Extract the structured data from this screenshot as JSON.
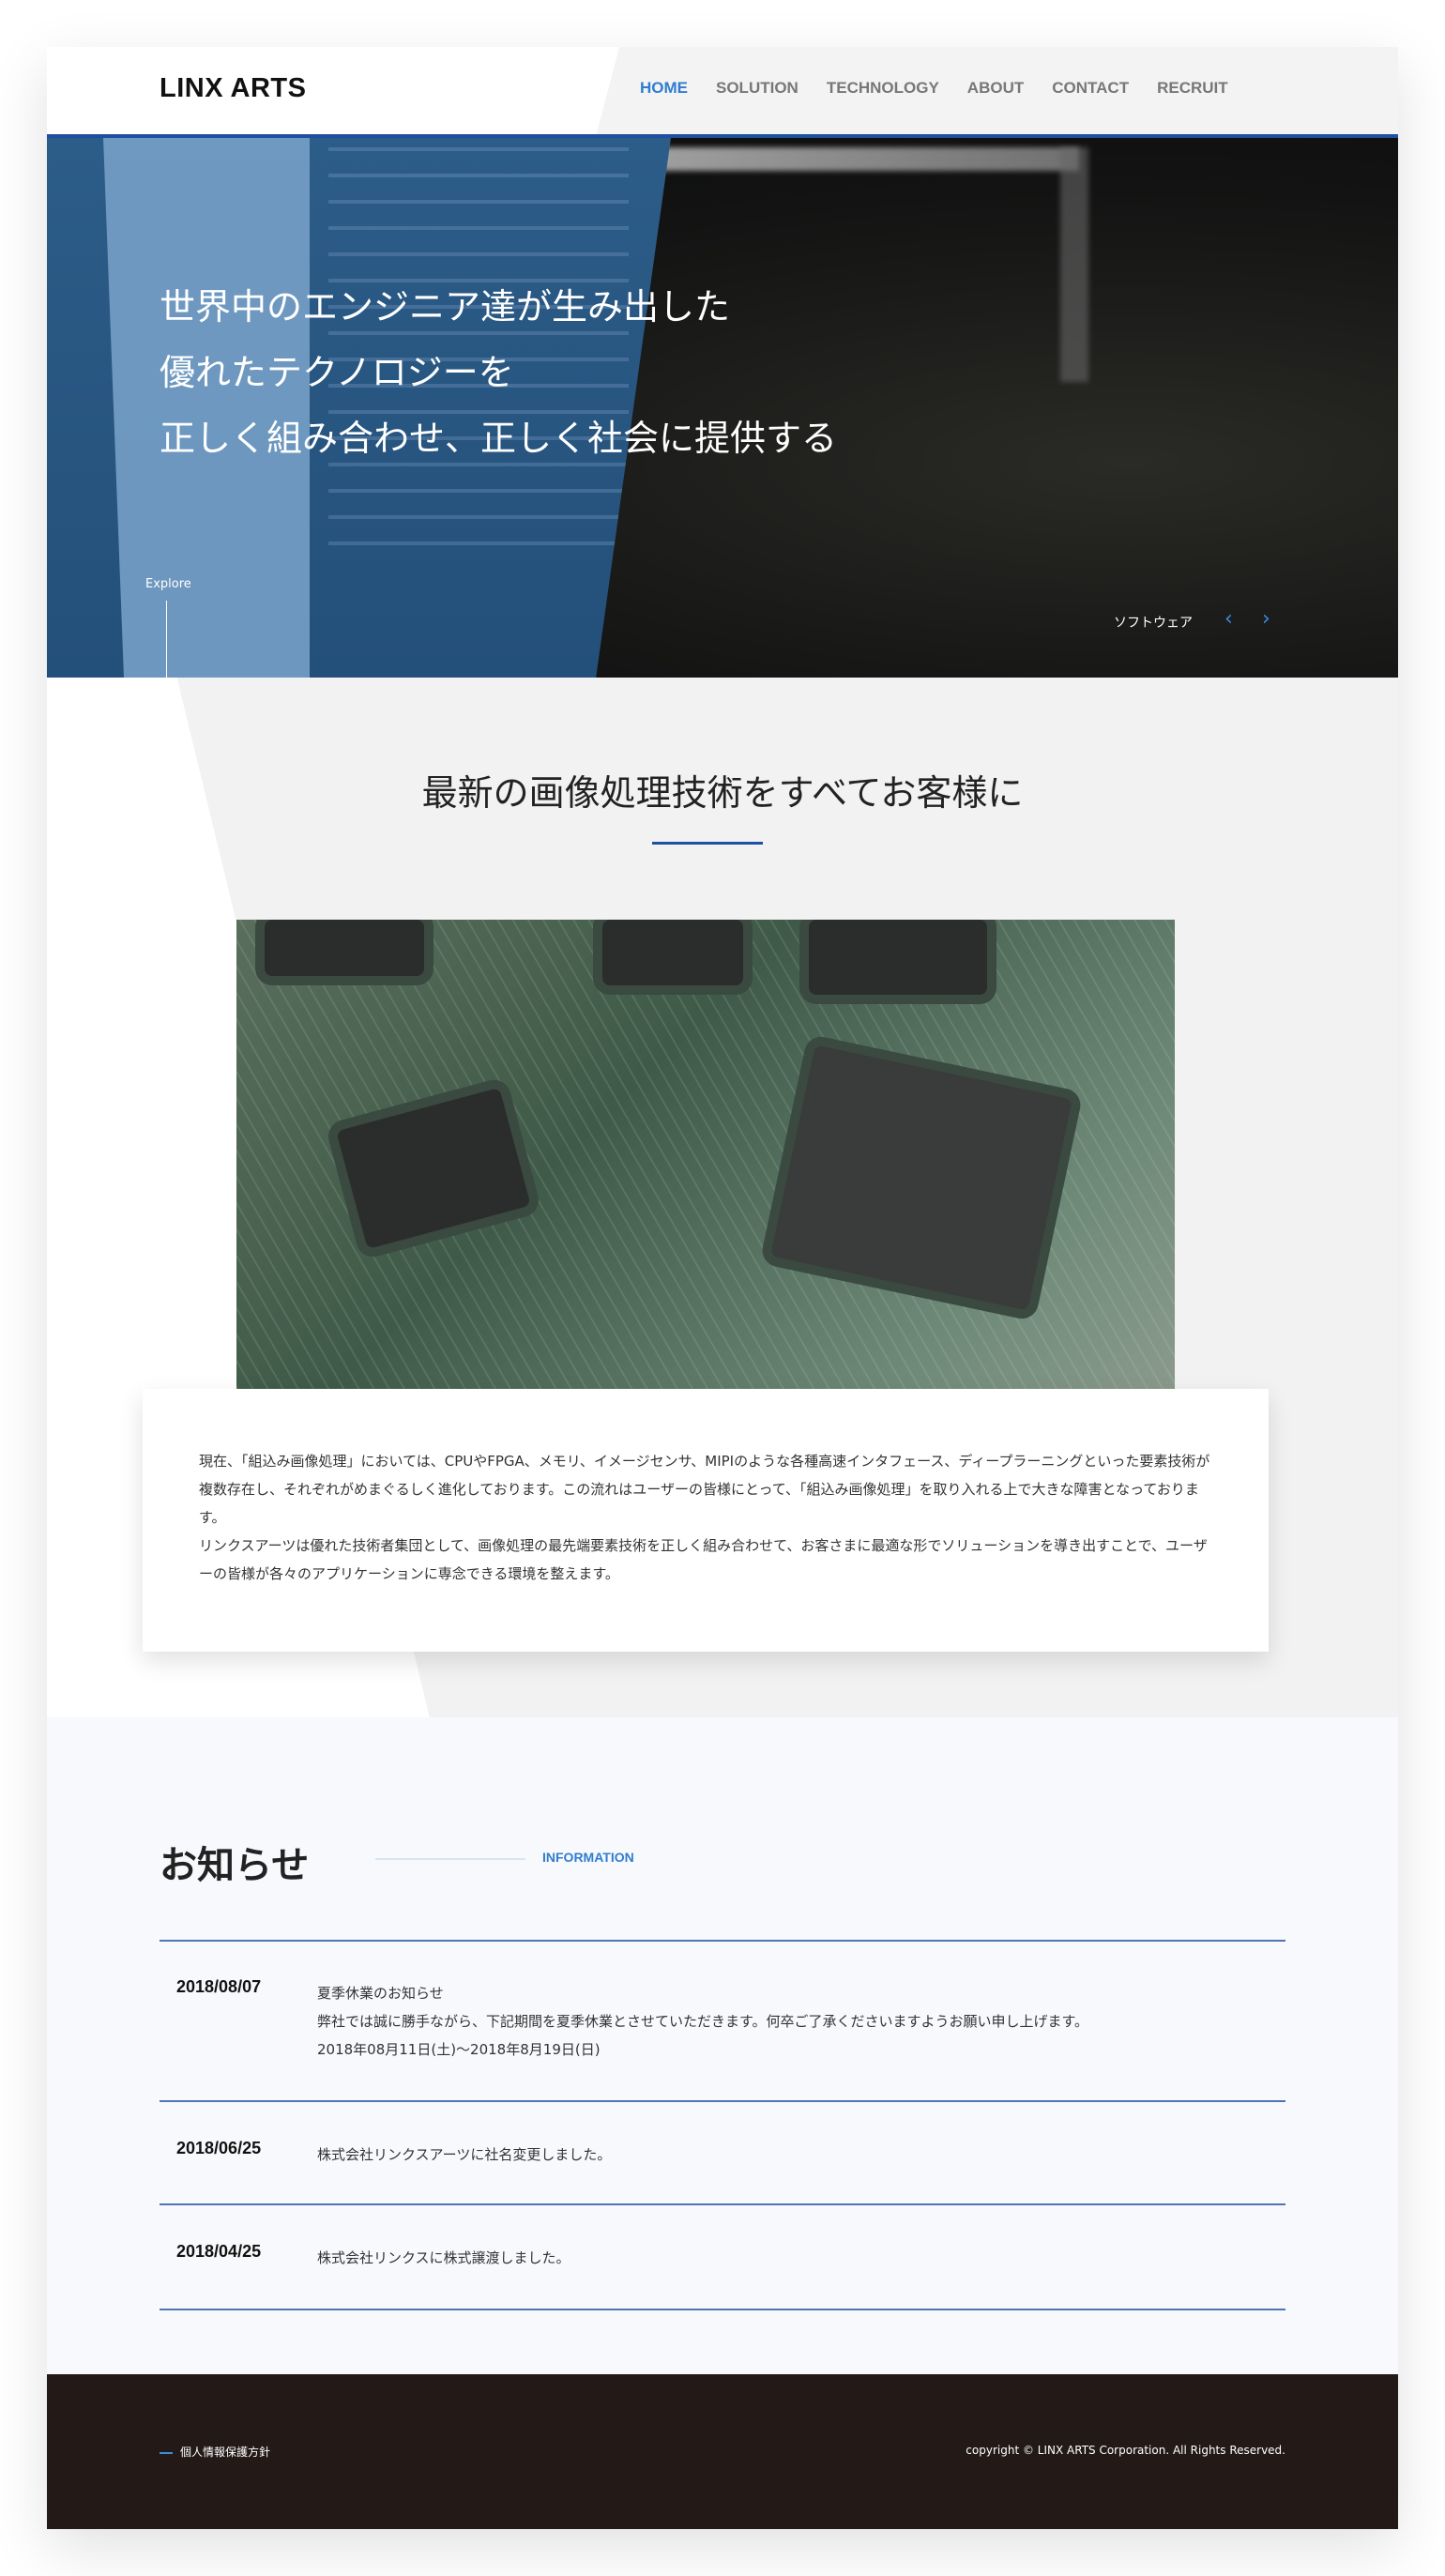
{
  "header": {
    "logo": "LINX ARTS",
    "nav": [
      "HOME",
      "SOLUTION",
      "TECHNOLOGY",
      "ABOUT",
      "CONTACT",
      "RECRUIT"
    ],
    "active": "HOME"
  },
  "hero": {
    "tagline": [
      "世界中のエンジニア達が生み出した",
      "優れたテクノロジーを",
      "正しく組み合わせ、正しく社会に提供する"
    ],
    "explore": "Explore",
    "slide_label": "ソフトウェア",
    "prev_icon": "chevron-left-icon",
    "next_icon": "chevron-right-icon"
  },
  "intro": {
    "title": "最新の画像処理技術をすべてお客様に",
    "paragraphs": [
      "現在、「組込み画像処理」においては、CPUやFPGA、メモリ、イメージセンサ、MIPIのような各種高速インタフェース、ディープラーニングといった要素技術が複数存在し、それぞれがめまぐるしく進化しております。この流れはユーザーの皆様にとって、「組込み画像処理」を取り入れる上で大きな障害となっております。",
      "リンクスアーツは優れた技術者集団として、画像処理の最先端要素技術を正しく組み合わせて、お客さまに最適な形でソリューションを導き出すことで、ユーザーの皆様が各々のアプリケーションに専念できる環境を整えます。"
    ]
  },
  "news": {
    "title": "お知らせ",
    "subtitle": "INFORMATION",
    "items": [
      {
        "date": "2018/08/07",
        "lines": [
          "夏季休業のお知らせ",
          "弊社では誠に勝手ながら、下記期間を夏季休業とさせていただきます。何卒ご了承くださいますようお願い申し上げます。",
          "2018年08月11日(土)～2018年8月19日(日)"
        ]
      },
      {
        "date": "2018/06/25",
        "lines": [
          "株式会社リンクスアーツに社名変更しました。"
        ]
      },
      {
        "date": "2018/04/25",
        "lines": [
          "株式会社リンクスに株式譲渡しました。"
        ]
      }
    ]
  },
  "footer": {
    "policy": "個人情報保護方針",
    "copyright": "copyright © LINX ARTS Corporation. All Rights Reserved."
  },
  "colors": {
    "accent": "#2f7dd1",
    "brand_blue": "#1f4fa0",
    "footer_bg": "#231a18",
    "section_bg": "#f7f9fc"
  }
}
